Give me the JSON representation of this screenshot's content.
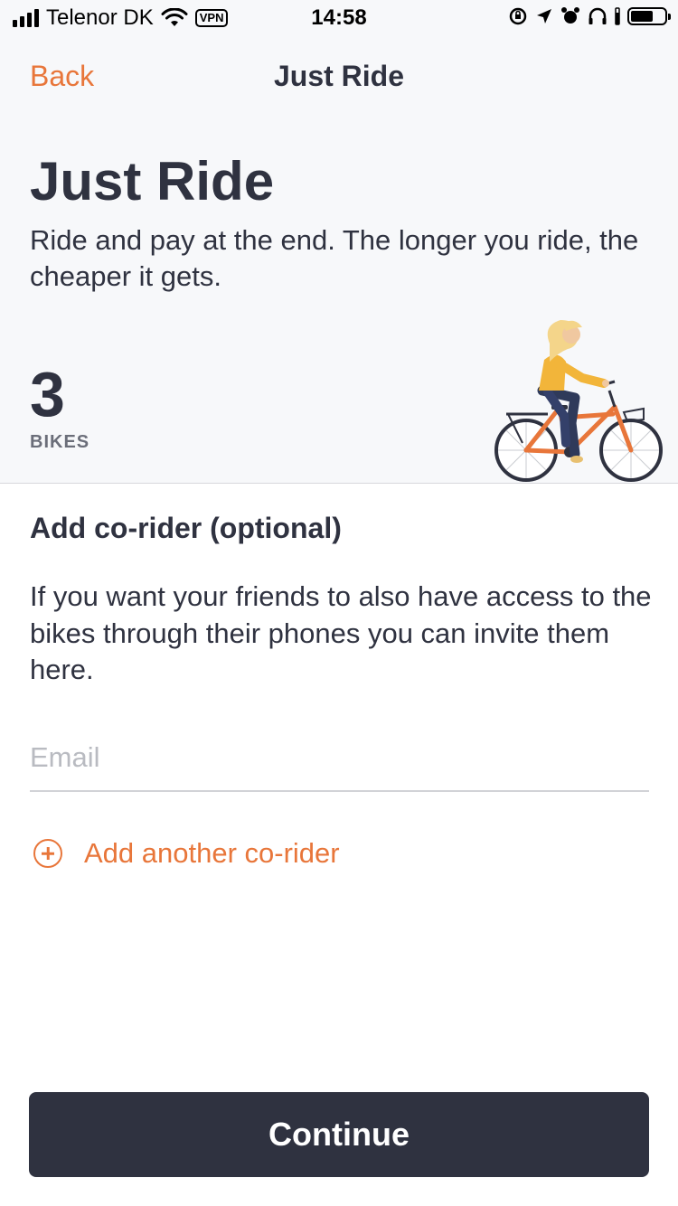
{
  "status_bar": {
    "carrier": "Telenor DK",
    "vpn": "VPN",
    "time": "14:58"
  },
  "nav": {
    "back_label": "Back",
    "title": "Just Ride"
  },
  "hero": {
    "title": "Just Ride",
    "description": "Ride and pay at the end. The longer you ride, the cheaper it gets.",
    "bike_count": "3",
    "bike_unit": "BIKES"
  },
  "co_rider": {
    "title": "Add co-rider (optional)",
    "description": "If you want your friends to also have access to the bikes through their phones you can invite them here.",
    "email_placeholder": "Email",
    "email_value": "",
    "add_another_label": "Add another co-rider"
  },
  "footer": {
    "continue_label": "Continue"
  },
  "colors": {
    "accent": "#e8763a",
    "dark": "#2f3240",
    "background_top": "#f7f8fa"
  }
}
